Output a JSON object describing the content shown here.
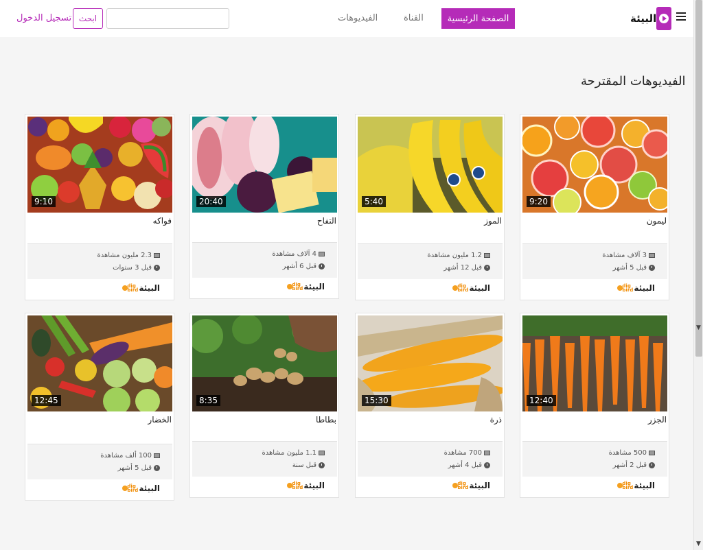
{
  "header": {
    "brand": "البيئة",
    "nav_home": "الصفحة الرئيسية",
    "nav_channel": "القناة",
    "nav_videos": "الفيديوهات",
    "search_placeholder": "",
    "search_button": "ابحث",
    "login": "تسجيل الدخول"
  },
  "section_title": "الفيديوهات المقترحة",
  "accent_color": "#b52bb8",
  "videos": [
    {
      "title": "ليمون",
      "duration": "9:20",
      "views": "3 آلاف مشاهدة",
      "age": "قبل 5 أشهر",
      "channel": "البيئة",
      "thumbnail": "citrus-slices"
    },
    {
      "title": "الموز",
      "duration": "5:40",
      "views": "1.2 مليون مشاهدة",
      "age": "قبل 12 أشهر",
      "channel": "البيئة",
      "thumbnail": "bananas"
    },
    {
      "title": "التفاح",
      "duration": "20:40",
      "views": "4 آلاف مشاهدة",
      "age": "قبل 6 أشهر",
      "channel": "البيئة",
      "thumbnail": "apple-slices"
    },
    {
      "title": "فواكه",
      "duration": "9:10",
      "views": "2.3 مليون مشاهدة",
      "age": "قبل 3 سنوات",
      "channel": "البيئة",
      "thumbnail": "mixed-fruits"
    },
    {
      "title": "الجزر",
      "duration": "12:40",
      "views": "500 مشاهدة",
      "age": "قبل 2 أشهر",
      "channel": "البيئة",
      "thumbnail": "carrots"
    },
    {
      "title": "ذرة",
      "duration": "15:30",
      "views": "700 مشاهدة",
      "age": "قبل 4 أشهر",
      "channel": "البيئة",
      "thumbnail": "corn"
    },
    {
      "title": "بطاطا",
      "duration": "8:35",
      "views": "1.1 مليون مشاهدة",
      "age": "قبل سنة",
      "channel": "البيئة",
      "thumbnail": "potatoes"
    },
    {
      "title": "الخضار",
      "duration": "12:45",
      "views": "100 ألف مشاهدة",
      "age": "قبل 5 أشهر",
      "channel": "البيئة",
      "thumbnail": "vegetables"
    }
  ]
}
